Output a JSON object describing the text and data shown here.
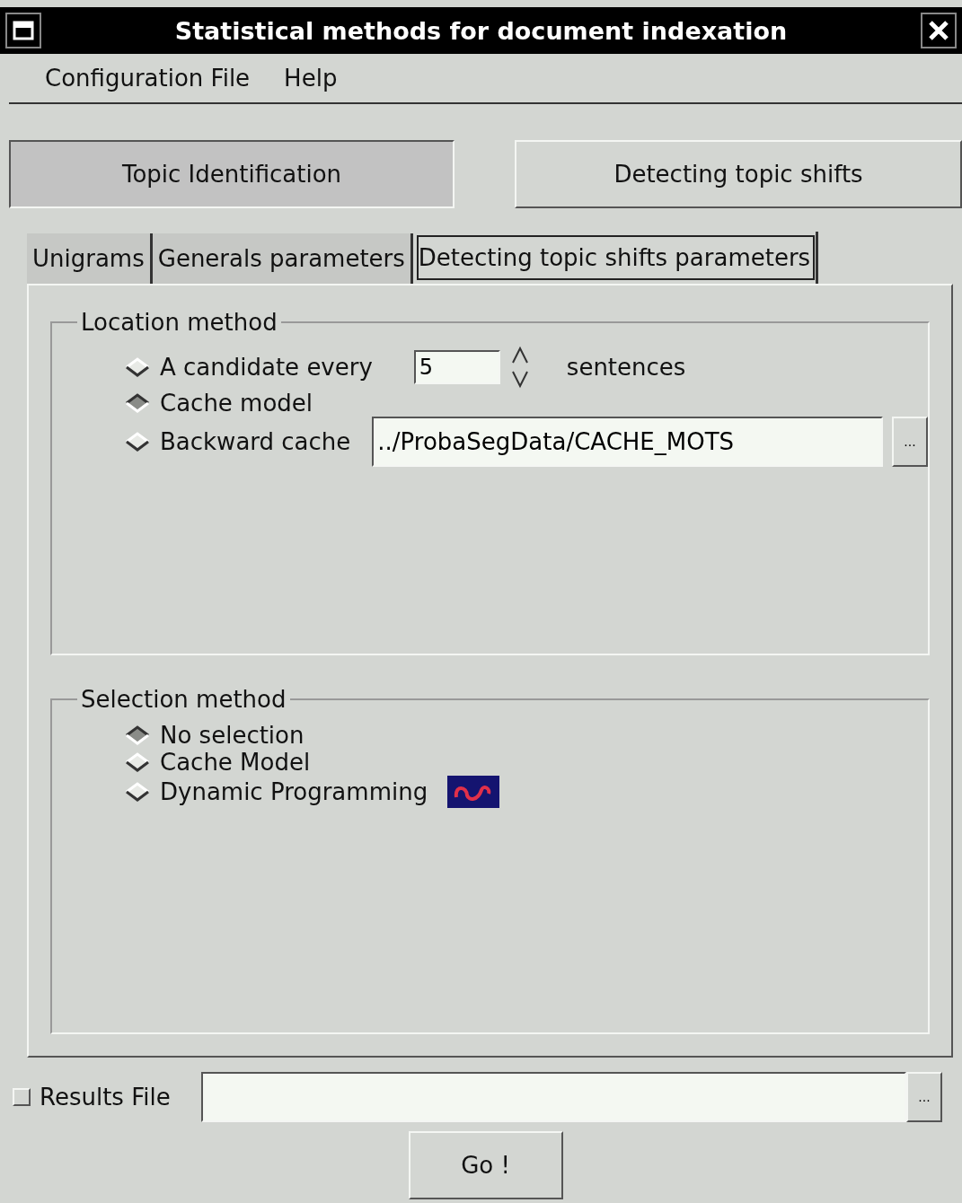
{
  "window": {
    "title": "Statistical methods for document indexation"
  },
  "menu": [
    "Configuration File",
    "Help"
  ],
  "modes": [
    {
      "label": "Topic Identification",
      "selected": true
    },
    {
      "label": "Detecting topic shifts",
      "selected": false
    }
  ],
  "tabs": [
    {
      "label": "Unigrams",
      "selected": false
    },
    {
      "label": "Generals parameters",
      "selected": false
    },
    {
      "label": "Detecting topic shifts parameters",
      "selected": true
    }
  ],
  "groups": [
    {
      "title": "Location method",
      "options": [
        {
          "kind": "spinner",
          "label": "A candidate every",
          "selected": false,
          "value": "5",
          "suffix": "sentences"
        },
        {
          "kind": "plain",
          "label": "Cache model",
          "selected": true
        },
        {
          "kind": "file",
          "label": "Backward cache",
          "selected": false,
          "value": "../ProbaSegData/CACHE_MOTS",
          "browse": "..."
        }
      ]
    },
    {
      "title": "Selection method",
      "options": [
        {
          "kind": "plain",
          "label": "No selection",
          "selected": true
        },
        {
          "kind": "plain",
          "label": "Cache Model",
          "selected": false
        },
        {
          "kind": "logo",
          "label": "Dynamic Programming",
          "selected": false
        }
      ]
    }
  ],
  "results": {
    "label": "Results File",
    "checked": false,
    "browse": "..."
  },
  "go": "Go !"
}
